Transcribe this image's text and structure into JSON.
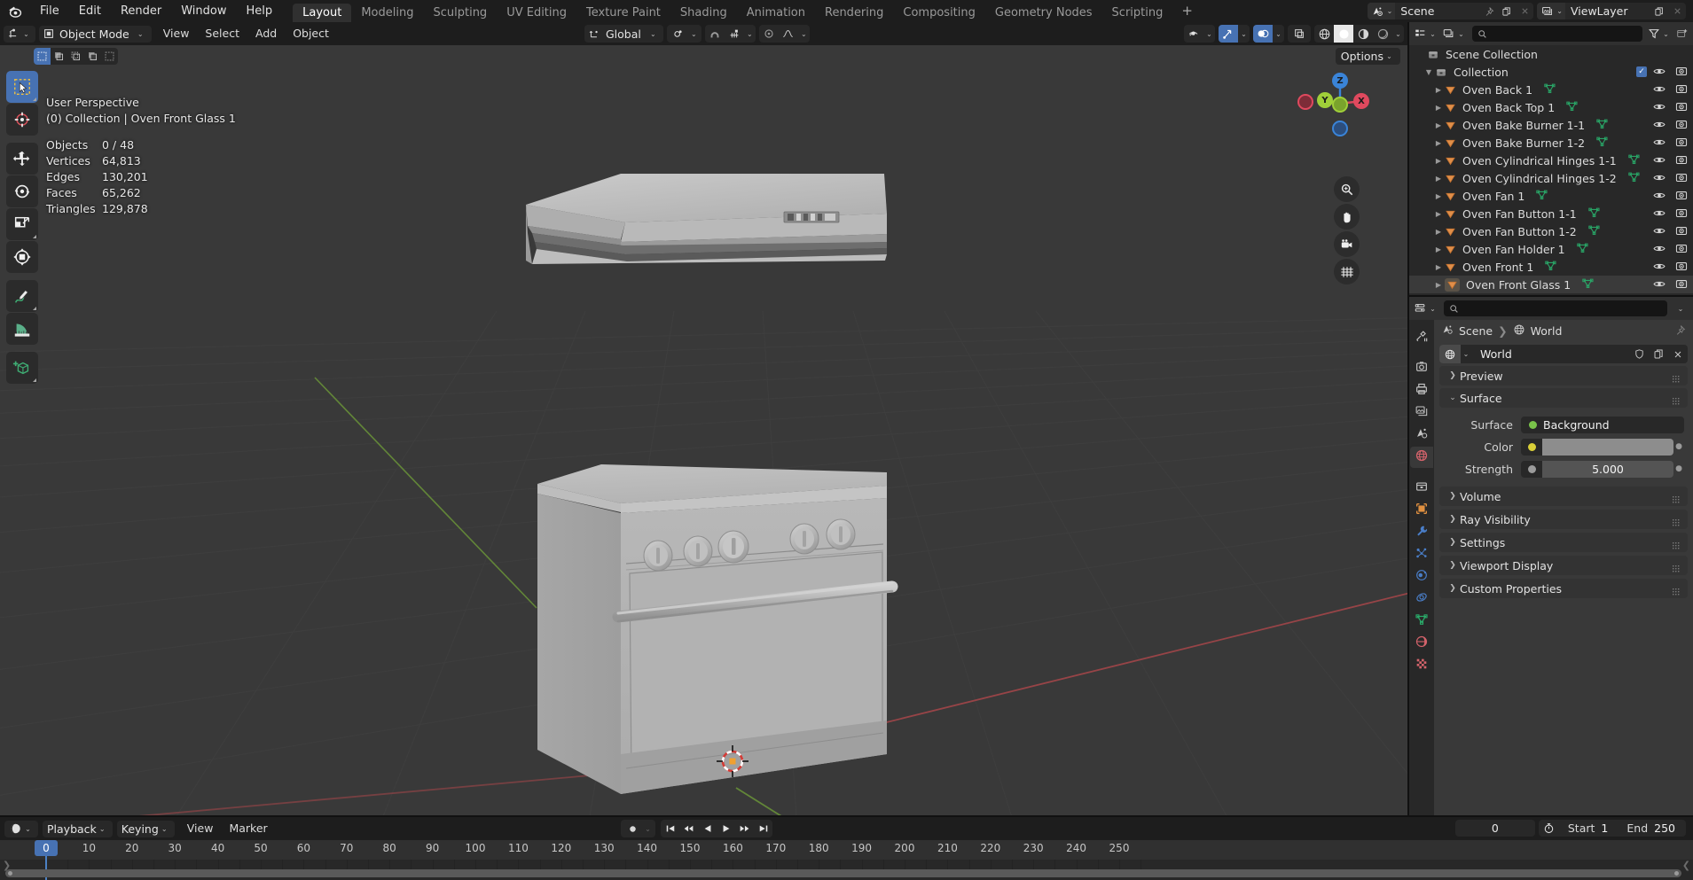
{
  "app": {
    "name": "Blender",
    "logo_icon": "blender-logo"
  },
  "topbar": {
    "menus": [
      "File",
      "Edit",
      "Render",
      "Window",
      "Help"
    ],
    "workspaces": [
      {
        "label": "Layout",
        "active": true
      },
      {
        "label": "Modeling",
        "active": false
      },
      {
        "label": "Sculpting",
        "active": false
      },
      {
        "label": "UV Editing",
        "active": false
      },
      {
        "label": "Texture Paint",
        "active": false
      },
      {
        "label": "Shading",
        "active": false
      },
      {
        "label": "Animation",
        "active": false
      },
      {
        "label": "Rendering",
        "active": false
      },
      {
        "label": "Compositing",
        "active": false
      },
      {
        "label": "Geometry Nodes",
        "active": false
      },
      {
        "label": "Scripting",
        "active": false
      }
    ],
    "add_workspace_label": "+",
    "scene": {
      "icon": "scene-icon",
      "name": "Scene",
      "pin_icon": "pin-icon",
      "new_icon": "new-copy-icon",
      "unlink_icon": "x-icon"
    },
    "viewlayer": {
      "icon": "viewlayer-icon",
      "name": "ViewLayer",
      "new_icon": "new-copy-icon",
      "unlink_icon": "x-icon"
    }
  },
  "viewport": {
    "header": {
      "editor_type_icon": "editor-type-3dview-icon",
      "mode": "Object Mode",
      "mode_icon": "object-mode-icon",
      "menus": [
        "View",
        "Select",
        "Add",
        "Object"
      ],
      "transform_orientation": "Global",
      "snap_icon": "magnet-icon",
      "proportional_icon": "proportional-edit-icon",
      "pivot_icon": "pivot-point-icon",
      "falloff_icon": "falloff-curve-icon",
      "visibility_icon": "visibility-icon",
      "gizmo_icon": "gizmo-icon",
      "overlays_icon": "overlays-icon",
      "xray_icon": "xray-toggle-icon",
      "shading_modes": [
        "wireframe",
        "solid",
        "material-preview",
        "rendered"
      ],
      "shading_active": "solid",
      "options_label": "Options"
    },
    "select_modes": [
      "tweak",
      "select-box",
      "select-circle",
      "select-lasso",
      "select-box-alt"
    ],
    "tools": [
      {
        "name": "select-box-tool",
        "active": true
      },
      {
        "name": "cursor-tool",
        "active": false
      },
      {
        "name": "move-tool",
        "active": false
      },
      {
        "name": "rotate-tool",
        "active": false
      },
      {
        "name": "scale-tool",
        "active": false
      },
      {
        "name": "transform-tool",
        "active": false
      },
      {
        "name": "annotate-tool",
        "active": false
      },
      {
        "name": "measure-tool",
        "active": false
      },
      {
        "name": "add-cube-tool",
        "active": false
      }
    ],
    "stats": {
      "perspective": "User Perspective",
      "context": "(0) Collection | Oven Front Glass 1",
      "rows": [
        {
          "key": "Objects",
          "value": "0 / 48"
        },
        {
          "key": "Vertices",
          "value": "64,813"
        },
        {
          "key": "Edges",
          "value": "130,201"
        },
        {
          "key": "Faces",
          "value": "65,262"
        },
        {
          "key": "Triangles",
          "value": "129,878"
        }
      ]
    },
    "gizmo": {
      "axes": [
        "X",
        "Y",
        "Z"
      ],
      "colors": {
        "x": "#e0495e",
        "y": "#a0cf39",
        "z": "#3a84d8"
      }
    },
    "nav_buttons": [
      "zoom-icon",
      "pan-hand-icon",
      "camera-icon",
      "ortho-grid-icon"
    ]
  },
  "outliner": {
    "display_mode_icon": "outliner-display-mode-icon",
    "filter_icon": "filter-icon",
    "new_collection_icon": "new-collection-icon",
    "search_icon": "search-icon",
    "search_value": "",
    "root": "Scene Collection",
    "collection": "Collection",
    "items": [
      {
        "label": "Oven Back 1",
        "selected": false
      },
      {
        "label": "Oven Back Top 1",
        "selected": false
      },
      {
        "label": "Oven Bake Burner 1-1",
        "selected": false
      },
      {
        "label": "Oven Bake Burner 1-2",
        "selected": false
      },
      {
        "label": "Oven Cylindrical Hinges 1-1",
        "selected": false
      },
      {
        "label": "Oven Cylindrical Hinges 1-2",
        "selected": false
      },
      {
        "label": "Oven Fan 1",
        "selected": false
      },
      {
        "label": "Oven Fan Button 1-1",
        "selected": false
      },
      {
        "label": "Oven Fan Button 1-2",
        "selected": false
      },
      {
        "label": "Oven Fan Holder 1",
        "selected": false
      },
      {
        "label": "Oven Front 1",
        "selected": false
      },
      {
        "label": "Oven Front Glass 1",
        "selected": true
      }
    ]
  },
  "properties": {
    "editor_icon": "properties-editor-icon",
    "search_value": "",
    "breadcrumb": [
      {
        "label": "Scene",
        "icon": "scene-icon"
      },
      {
        "label": "World",
        "icon": "world-icon"
      }
    ],
    "id_name": "World",
    "id_icon": "world-icon",
    "id_fake_user_icon": "shield-icon",
    "id_new_icon": "copy-icon",
    "id_unlink_icon": "x-icon",
    "tabs": [
      {
        "name": "tool",
        "icon": "tool-icon",
        "active": false
      },
      {
        "name": "render",
        "icon": "render-icon",
        "active": false
      },
      {
        "name": "output",
        "icon": "output-printer-icon",
        "active": false
      },
      {
        "name": "view-layer",
        "icon": "view-layer-images-icon",
        "active": false
      },
      {
        "name": "scene",
        "icon": "scene-cone-icon",
        "active": false
      },
      {
        "name": "world",
        "icon": "world-globe-icon",
        "active": true
      },
      {
        "name": "collection",
        "icon": "collection-box-icon",
        "active": false
      },
      {
        "name": "object",
        "icon": "object-square-icon",
        "active": false
      },
      {
        "name": "modifiers",
        "icon": "wrench-icon",
        "active": false
      },
      {
        "name": "particles",
        "icon": "particles-icon",
        "active": false
      },
      {
        "name": "physics",
        "icon": "physics-orbit-icon",
        "active": false
      },
      {
        "name": "constraints",
        "icon": "constraints-icon",
        "active": false
      },
      {
        "name": "data",
        "icon": "mesh-data-triangle-icon",
        "active": false
      },
      {
        "name": "material",
        "icon": "material-sphere-icon",
        "active": false
      },
      {
        "name": "texture",
        "icon": "texture-checker-icon",
        "active": false
      }
    ],
    "panels": [
      {
        "label": "Preview",
        "open": false
      },
      {
        "label": "Surface",
        "open": true
      },
      {
        "label": "Volume",
        "open": false
      },
      {
        "label": "Ray Visibility",
        "open": false
      },
      {
        "label": "Settings",
        "open": false
      },
      {
        "label": "Viewport Display",
        "open": false
      },
      {
        "label": "Custom Properties",
        "open": false
      }
    ],
    "surface": {
      "surface_label": "Surface",
      "surface_value": "Background",
      "surface_socket_color": "#7ac44a",
      "color_label": "Color",
      "color_value": "#d9cf38",
      "strength_label": "Strength",
      "strength_value": "5.000",
      "strength_socket_color": "#9b9b9b"
    }
  },
  "timeline": {
    "editor_icon": "timeline-editor-icon",
    "menus": [
      {
        "label": "Playback",
        "has_chevron": true
      },
      {
        "label": "Keying",
        "has_chevron": true
      },
      {
        "label": "View",
        "has_chevron": false
      },
      {
        "label": "Marker",
        "has_chevron": false
      }
    ],
    "autokey_icon": "record-dot-icon",
    "transport": [
      "jump-start-icon",
      "prev-keyframe-icon",
      "play-reverse-icon",
      "play-icon",
      "next-keyframe-icon",
      "jump-end-icon"
    ],
    "current_frame": "0",
    "timer_icon": "stopwatch-icon",
    "start_label": "Start",
    "start_value": "1",
    "end_label": "End",
    "end_value": "250",
    "ticks": [
      "0",
      "10",
      "20",
      "30",
      "40",
      "50",
      "60",
      "70",
      "80",
      "90",
      "100",
      "110",
      "120",
      "130",
      "140",
      "150",
      "160",
      "170",
      "180",
      "190",
      "200",
      "210",
      "220",
      "230",
      "240",
      "250"
    ],
    "playhead_label": "0"
  },
  "colors": {
    "accent_blue": "#4772b3",
    "viewport_bg": "#393939",
    "panel_bg": "#282828",
    "header_bg": "#1d1d1d",
    "mesh_orange": "#e08f4a",
    "mesh_data_green": "#2aab6a",
    "axis_x_red": "#a8464a",
    "axis_y_green": "#6a9438"
  }
}
